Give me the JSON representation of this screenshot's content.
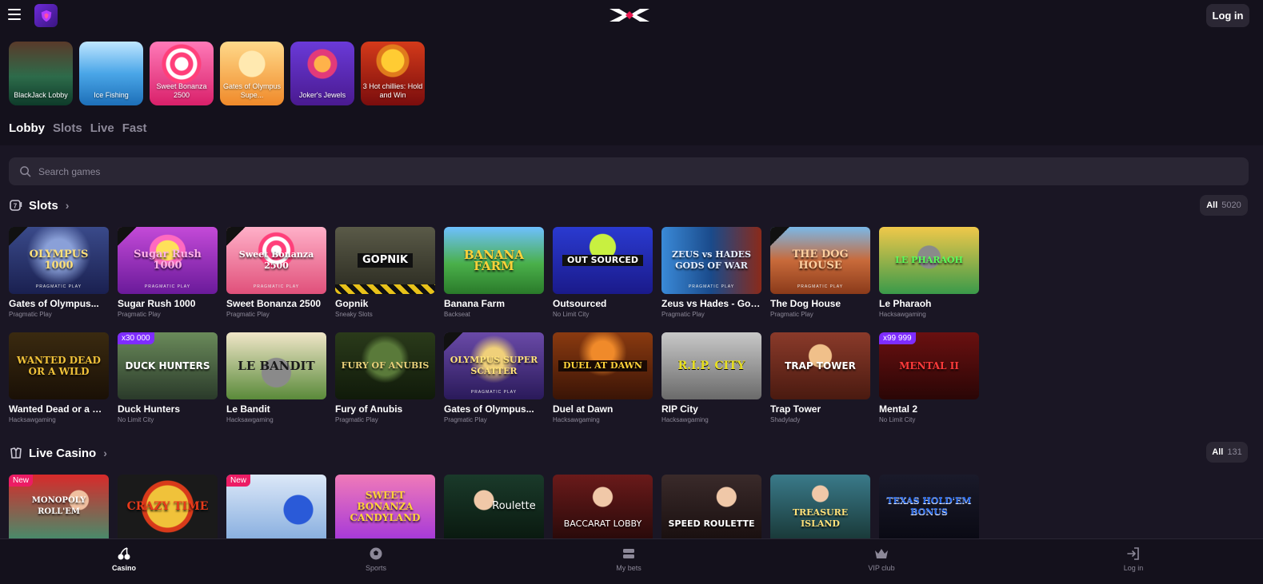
{
  "header": {
    "login_label": "Log in"
  },
  "stories": [
    {
      "label": "BlackJack Lobby",
      "icon": "dealer-portrait"
    },
    {
      "label": "Ice Fishing",
      "icon": "dealer-portrait"
    },
    {
      "label": "Sweet Bonanza 2500",
      "icon": "lollipop"
    },
    {
      "label": "Gates of Olympus Supe...",
      "icon": "zeus"
    },
    {
      "label": "Joker's Jewels",
      "icon": "joker"
    },
    {
      "label": "3 Hot chillies: Hold and Win",
      "icon": "mariachi"
    }
  ],
  "categories": [
    "Lobby",
    "Slots",
    "Live",
    "Fast"
  ],
  "search": {
    "placeholder": "Search games"
  },
  "slots_section": {
    "title": "Slots",
    "all_label": "All",
    "count": "5020",
    "row1": [
      {
        "name": "Gates of Olympus...",
        "provider": "Pragmatic Play",
        "art": "OLYMPUS 1000"
      },
      {
        "name": "Sugar Rush 1000",
        "provider": "Pragmatic Play",
        "art": "Sugar Rush 1000"
      },
      {
        "name": "Sweet Bonanza 2500",
        "provider": "Pragmatic Play",
        "art": "Sweet Bonanza 2500"
      },
      {
        "name": "Gopnik",
        "provider": "Sneaky Slots",
        "art": "GOPNIK"
      },
      {
        "name": "Banana Farm",
        "provider": "Backseat",
        "art": "BANANA FARM"
      },
      {
        "name": "Outsourced",
        "provider": "No Limit City",
        "art": "OUT SOURCED"
      },
      {
        "name": "Zeus vs Hades - God...",
        "provider": "Pragmatic Play",
        "art": "ZEUS vs HADES GODS OF WAR"
      },
      {
        "name": "The Dog House",
        "provider": "Pragmatic Play",
        "art": "THE DOG HOUSE"
      },
      {
        "name": "Le Pharaoh",
        "provider": "Hacksawgaming",
        "art": "LE PHARAOH"
      }
    ],
    "row2": [
      {
        "name": "Wanted Dead or a Wild",
        "provider": "Hacksawgaming",
        "art": "WANTED DEAD OR A WILD",
        "badge": ""
      },
      {
        "name": "Duck Hunters",
        "provider": "No Limit City",
        "art": "DUCK HUNTERS",
        "badge": "x30 000"
      },
      {
        "name": "Le Bandit",
        "provider": "Hacksawgaming",
        "art": "LE BANDIT",
        "badge": ""
      },
      {
        "name": "Fury of Anubis",
        "provider": "Pragmatic Play",
        "art": "FURY OF ANUBIS",
        "badge": ""
      },
      {
        "name": "Gates of Olympus...",
        "provider": "Pragmatic Play",
        "art": "OLYMPUS SUPER SCATTER",
        "badge": ""
      },
      {
        "name": "Duel at Dawn",
        "provider": "Hacksawgaming",
        "art": "DUEL AT DAWN",
        "badge": ""
      },
      {
        "name": "RIP City",
        "provider": "Hacksawgaming",
        "art": "R.I.P. CITY",
        "badge": ""
      },
      {
        "name": "Trap Tower",
        "provider": "Shadylady",
        "art": "TRAP TOWER",
        "badge": ""
      },
      {
        "name": "Mental 2",
        "provider": "No Limit City",
        "art": "MENTAL II",
        "badge": "x99 999"
      }
    ]
  },
  "live_section": {
    "title": "Live Casino",
    "all_label": "All",
    "count": "131",
    "row": [
      {
        "art": "MONOPOLY ROLL'EM",
        "badge": "New"
      },
      {
        "art": "CRAZY TIME",
        "badge": ""
      },
      {
        "art": "",
        "badge": "New"
      },
      {
        "art": "SWEET BONANZA CANDYLAND",
        "badge": ""
      },
      {
        "art": "Roulette",
        "badge": ""
      },
      {
        "art": "BACCARAT LOBBY",
        "badge": ""
      },
      {
        "art": "SPEED ROULETTE",
        "badge": ""
      },
      {
        "art": "TREASURE ISLAND",
        "badge": ""
      },
      {
        "art": "TEXAS HOLD'EM BONUS",
        "badge": ""
      }
    ]
  },
  "bottom_nav": [
    {
      "label": "Casino",
      "icon": "cherries-icon"
    },
    {
      "label": "Sports",
      "icon": "soccer-ball-icon"
    },
    {
      "label": "My bets",
      "icon": "tickets-icon"
    },
    {
      "label": "VIP club",
      "icon": "crown-icon"
    },
    {
      "label": "Log in",
      "icon": "login-icon"
    }
  ],
  "colors": {
    "background": "#14111c",
    "panel": "#1a1624",
    "input": "#2a2634",
    "muted_text": "#8c8898",
    "badge_purple": "#7e2cff",
    "badge_new": "#ec1c64"
  }
}
